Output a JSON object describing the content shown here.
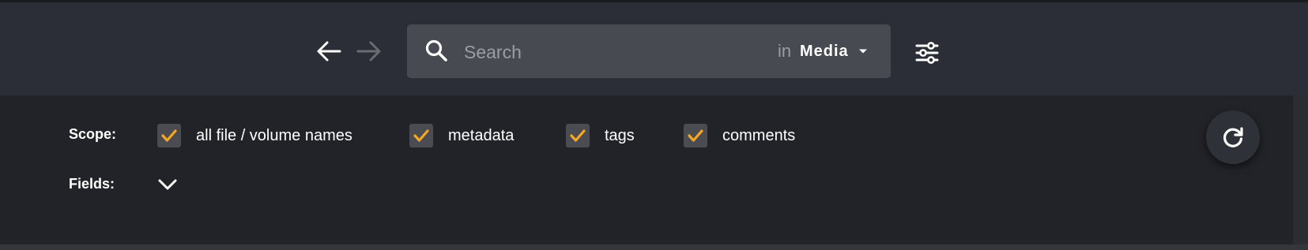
{
  "toolbar": {
    "back_icon": "arrow-left-icon",
    "forward_icon": "arrow-right-icon",
    "search": {
      "icon": "search-icon",
      "placeholder": "Search",
      "value": "",
      "in_label": "in",
      "scope_value": "Media",
      "caret_icon": "caret-down-icon"
    },
    "options_icon": "sliders-icon"
  },
  "panel": {
    "scope_label": "Scope:",
    "scope_options": [
      {
        "label": "all file / volume names",
        "checked": true
      },
      {
        "label": "metadata",
        "checked": true
      },
      {
        "label": "tags",
        "checked": true
      },
      {
        "label": "comments",
        "checked": true
      }
    ],
    "fields_label": "Fields:",
    "fields_toggle_icon": "chevron-down-icon",
    "refresh_icon": "refresh-icon"
  },
  "colors": {
    "toolbar_bg": "#2b2e36",
    "panel_bg": "#222328",
    "search_bg": "#474a50",
    "checkbox_bg": "#4a4c52",
    "check_mark": "#f5a623",
    "text": "#ffffff",
    "muted_text": "#9b9da2"
  }
}
